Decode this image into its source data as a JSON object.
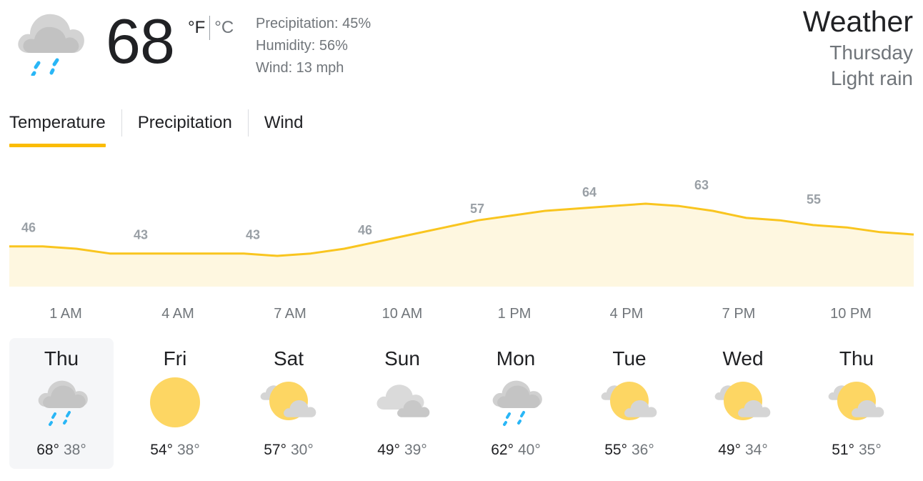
{
  "current": {
    "icon": "rain-cloud-icon",
    "temperature": "68",
    "unit_f": "°F",
    "unit_c": "°C",
    "precipitation": "Precipitation: 45%",
    "humidity": "Humidity: 56%",
    "wind": "Wind: 13 mph"
  },
  "header": {
    "title": "Weather",
    "day": "Thursday",
    "condition": "Light rain"
  },
  "tabs": [
    {
      "label": "Temperature",
      "active": true
    },
    {
      "label": "Precipitation",
      "active": false
    },
    {
      "label": "Wind",
      "active": false
    }
  ],
  "colors": {
    "accent": "#fbbc04",
    "area_fill": "#fef7e0",
    "line": "#f9c51f",
    "text_primary": "#202124",
    "text_secondary": "#70757a"
  },
  "chart_data": {
    "type": "area",
    "x": [
      "1 AM",
      "4 AM",
      "7 AM",
      "10 AM",
      "1 PM",
      "4 PM",
      "7 PM",
      "10 PM"
    ],
    "values": [
      46,
      43,
      43,
      46,
      57,
      64,
      63,
      55
    ],
    "data_labels": [
      "46",
      "43",
      "43",
      "46",
      "57",
      "64",
      "63",
      "55"
    ],
    "hourly_series": [
      46,
      46,
      45,
      43,
      43,
      43,
      43,
      43,
      42,
      43,
      45,
      48,
      51,
      54,
      57,
      59,
      61,
      62,
      63,
      64,
      63,
      61,
      58,
      57,
      55,
      54,
      52,
      51
    ]
  },
  "forecast": [
    {
      "day": "Thu",
      "icon": "rain-cloud-icon",
      "high": "68°",
      "low": "38°",
      "selected": true
    },
    {
      "day": "Fri",
      "icon": "sun-icon",
      "high": "54°",
      "low": "38°",
      "selected": false
    },
    {
      "day": "Sat",
      "icon": "partly-cloudy-icon",
      "high": "57°",
      "low": "30°",
      "selected": false
    },
    {
      "day": "Sun",
      "icon": "cloudy-icon",
      "high": "49°",
      "low": "39°",
      "selected": false
    },
    {
      "day": "Mon",
      "icon": "rain-cloud-icon",
      "high": "62°",
      "low": "40°",
      "selected": false
    },
    {
      "day": "Tue",
      "icon": "partly-cloudy-icon",
      "high": "55°",
      "low": "36°",
      "selected": false
    },
    {
      "day": "Wed",
      "icon": "partly-cloudy-icon",
      "high": "49°",
      "low": "34°",
      "selected": false
    },
    {
      "day": "Thu",
      "icon": "partly-cloudy-icon",
      "high": "51°",
      "low": "35°",
      "selected": false
    }
  ]
}
